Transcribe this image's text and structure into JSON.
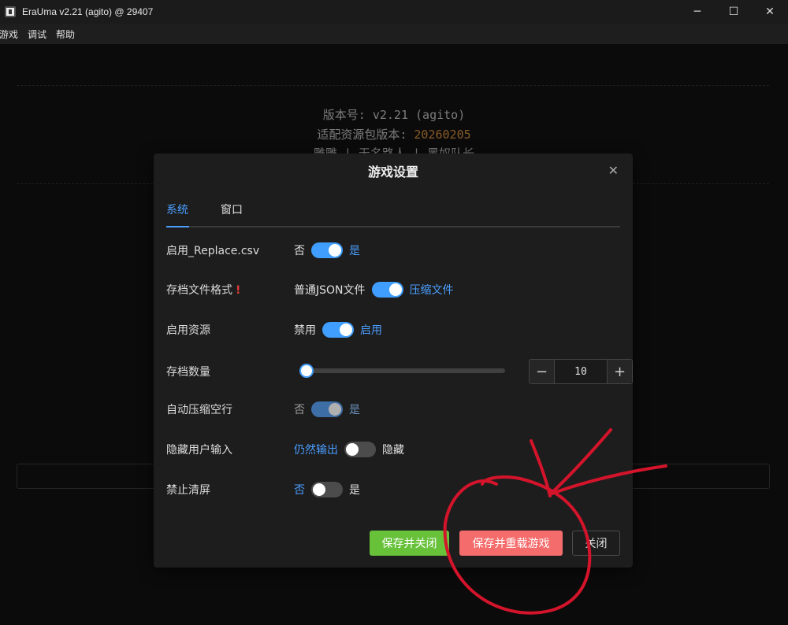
{
  "window": {
    "title": "EraUma v2.21 (agito) @ 29407",
    "minimize_glyph": "─",
    "maximize_glyph": "☐",
    "close_glyph": "✕"
  },
  "menu": {
    "items": [
      "游戏",
      "调试",
      "帮助"
    ]
  },
  "background": {
    "version_line": "版本号: v2.21 (agito)",
    "resource_label": "适配资源包版本: ",
    "resource_version": "20260205",
    "credits_line": "雕雕 | 无名路人 | 黑奴队长"
  },
  "dialog": {
    "title": "游戏设置",
    "close_glyph": "✕",
    "tabs": [
      {
        "label": "系统",
        "active": true
      },
      {
        "label": "窗口",
        "active": false
      }
    ],
    "settings": {
      "replace_csv": {
        "label": "启用_Replace.csv",
        "off_text": "否",
        "on_text": "是",
        "value": true
      },
      "save_format": {
        "label": "存档文件格式",
        "warn": "!",
        "off_text": "普通JSON文件",
        "on_text": "压缩文件",
        "value": true
      },
      "enable_resources": {
        "label": "启用资源",
        "off_text": "禁用",
        "on_text": "启用",
        "value": true
      },
      "save_count": {
        "label": "存档数量",
        "value": 10,
        "slider_fraction": 0.0,
        "minus": "−",
        "plus": "+"
      },
      "auto_compress": {
        "label": "自动压缩空行",
        "off_text": "否",
        "on_text": "是",
        "value": true,
        "disabled": true
      },
      "hide_input": {
        "label": "隐藏用户输入",
        "off_text": "仍然输出",
        "on_text": "隐藏",
        "value": false
      },
      "no_clear": {
        "label": "禁止清屏",
        "off_text": "否",
        "on_text": "是",
        "value": false
      }
    },
    "buttons": {
      "save_close": "保存并关闭",
      "save_reload": "保存并重载游戏",
      "close": "关闭"
    }
  },
  "colors": {
    "accent": "#409eff",
    "success": "#67c23a",
    "danger": "#f56c6c",
    "annotation": "#d4142a"
  }
}
